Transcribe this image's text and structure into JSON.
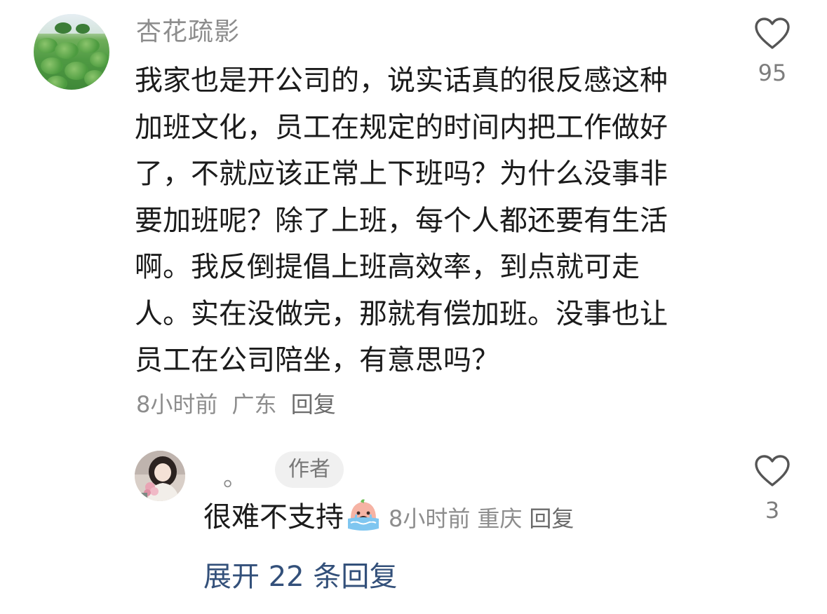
{
  "main_comment": {
    "username": "杏花疏影",
    "lines": [
      "我家也是开公司的，说实话真的很反感这种",
      "加班文化，员工在规定的时间内把工作做好",
      "了，不就应该正常上下班吗？为什么没事非",
      "要加班呢？除了上班，每个人都还要有生活",
      "啊。我反倒提倡上班高效率，到点就可走",
      "人。实在没做完，那就有偿加班。没事也让",
      "员工在公司陪坐，有意思吗？"
    ],
    "time": "8小时前",
    "location": "广东",
    "reply_label": "回复",
    "like_count": "95",
    "like_icon": "heart-outline-icon"
  },
  "reply_comment": {
    "username": "。",
    "badge": "作者",
    "text": "很难不支持",
    "emoji": "crying-face-emoji",
    "time": "8小时前",
    "location": "重庆",
    "reply_label": "回复",
    "like_count": "3",
    "like_icon": "heart-outline-icon"
  },
  "expand": {
    "label": "展开 22 条回复"
  },
  "colors": {
    "text_primary": "#1b1b1b",
    "text_secondary": "#8d8d8d",
    "link": "#33507a",
    "badge_bg": "#f0f0f0"
  }
}
